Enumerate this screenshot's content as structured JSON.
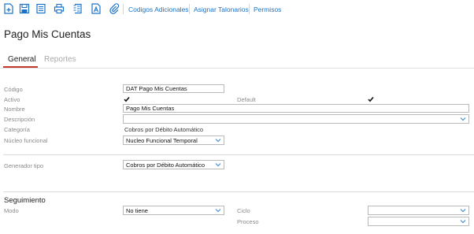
{
  "toolbar": {
    "icons": [
      "new-document-icon",
      "save-icon",
      "notes-icon",
      "print-icon",
      "document-list-icon",
      "text-document-icon",
      "attachment-icon"
    ],
    "links": [
      "Codigos Adicionales",
      "Asignar Talonarios",
      "Permisos"
    ],
    "accent_color": "#1a73c8"
  },
  "page": {
    "title": "Pago Mis Cuentas"
  },
  "tabs": [
    {
      "label": "General",
      "active": true
    },
    {
      "label": "Reportes",
      "active": false
    }
  ],
  "form": {
    "codigo": {
      "label": "Código",
      "value": "DAT Pago Mis Cuentas"
    },
    "activo": {
      "label": "Activo",
      "checked": true
    },
    "default": {
      "label": "Default",
      "checked": true
    },
    "nombre": {
      "label": "Nombre",
      "value": "Pago Mis Cuentas"
    },
    "descripcion": {
      "label": "Descripción",
      "value": ""
    },
    "categoria": {
      "label": "Categoría",
      "value": "Cobros por Débito Automático"
    },
    "nucleo": {
      "label": "Núcleo funcional",
      "value": "Nucleo Funcional Temporal"
    },
    "generador": {
      "label": "Generador tipo",
      "value": "Cobros por Débito Automático"
    }
  },
  "seguimiento": {
    "title": "Seguimiento",
    "modo": {
      "label": "Modo",
      "value": "No tiene"
    },
    "ciclo": {
      "label": "Ciclo",
      "value": ""
    },
    "proceso": {
      "label": "Proceso",
      "value": ""
    }
  },
  "colors": {
    "tab_underline": "#c0392b",
    "label": "#8a8a8a"
  }
}
